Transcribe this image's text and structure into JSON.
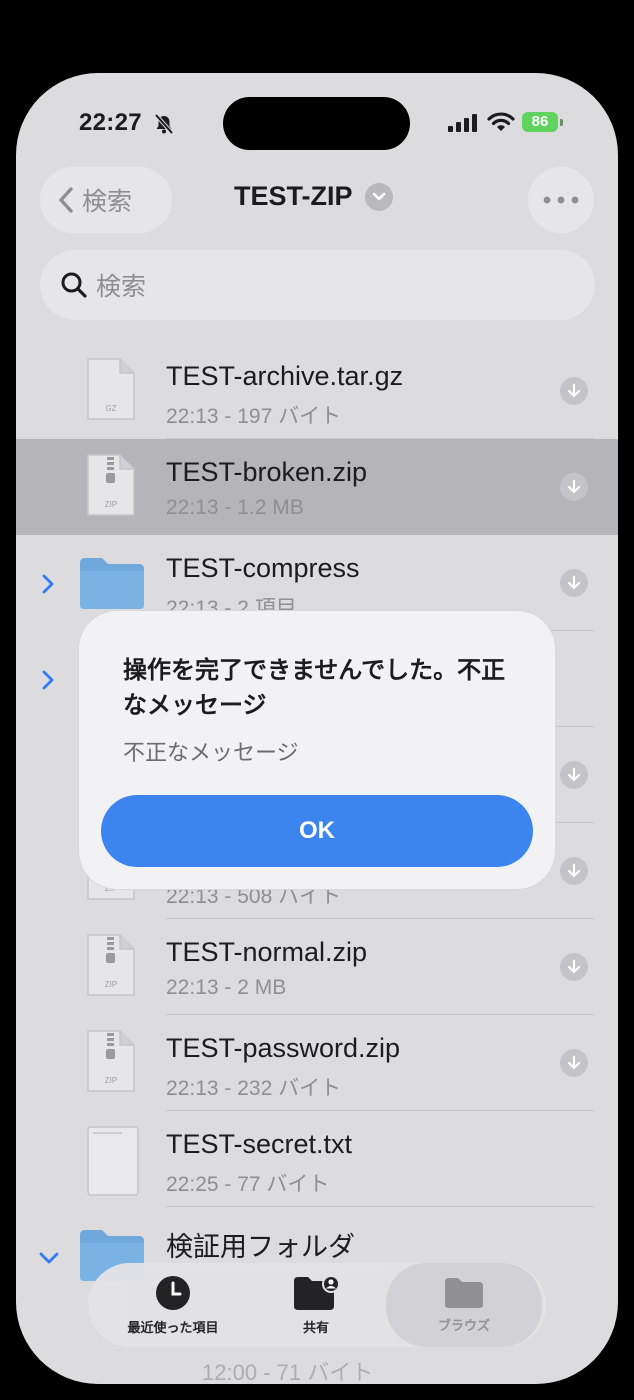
{
  "status_bar": {
    "time": "22:27",
    "battery": "86"
  },
  "nav": {
    "back_label": "検索",
    "title": "TEST-ZIP"
  },
  "search": {
    "placeholder": "検索"
  },
  "files": [
    {
      "name": "TEST-archive.tar.gz",
      "meta": "22:13 - 197 バイト",
      "icon": "gz-file-icon",
      "icon_text": "GZ"
    },
    {
      "name": "TEST-broken.zip",
      "meta": "22:13 - 1.2 MB",
      "icon": "zip-file-icon",
      "icon_text": "ZIP",
      "selected": true
    },
    {
      "name": "TEST-compress",
      "meta": "22:13 - 2 項目",
      "icon": "folder-icon"
    },
    {
      "name": "",
      "meta": "",
      "icon": "folder-icon"
    },
    {
      "name": "",
      "meta": "",
      "icon": "zip-file-icon"
    },
    {
      "name": "",
      "meta": "22:13 - 508 バイト",
      "icon": "zip-file-icon",
      "icon_text": "ZIP"
    },
    {
      "name": "TEST-normal.zip",
      "meta": "22:13 - 2 MB",
      "icon": "zip-file-icon",
      "icon_text": "ZIP"
    },
    {
      "name": "TEST-password.zip",
      "meta": "22:13 - 232 バイト",
      "icon": "zip-file-icon",
      "icon_text": "ZIP"
    },
    {
      "name": "TEST-secret.txt",
      "meta": "22:25 - 77 バイト",
      "icon": "txt-file-icon"
    },
    {
      "name": "検証用フォルダ",
      "meta": "",
      "icon": "folder-icon"
    }
  ],
  "behind_text": "12:00 - 71 バイト",
  "tabbar": {
    "recents": "最近使った項目",
    "shared": "共有",
    "browse": "ブラウズ"
  },
  "alert": {
    "title": "操作を完了できませんでした。不正なメッセージ",
    "message": "不正なメッセージ",
    "ok_label": "OK"
  },
  "colors": {
    "accent": "#3c84ee",
    "folder": "#6fa8dc",
    "battery": "#5fd35e"
  }
}
